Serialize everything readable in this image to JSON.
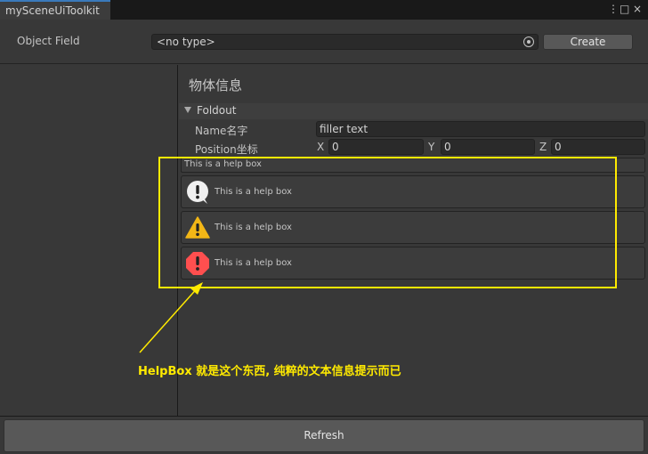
{
  "window": {
    "tab_title": "mySceneUiToolkit",
    "controls": [
      "⋮",
      "□",
      "×"
    ]
  },
  "toolbar": {
    "object_field_label": "Object Field",
    "object_field_value": "<no type>",
    "create_label": "Create"
  },
  "panel": {
    "title": "物体信息",
    "foldout_label": "Foldout",
    "name_label": "Name名字",
    "name_value": "filler text",
    "position_label": "Position坐标",
    "x_label": "X",
    "x_value": "0",
    "y_label": "Y",
    "y_value": "0",
    "z_label": "Z",
    "z_value": "0"
  },
  "helpboxes": [
    {
      "type": "none",
      "text": "This is a help box"
    },
    {
      "type": "info",
      "text": "This is a help box"
    },
    {
      "type": "warning",
      "text": "This is a help box"
    },
    {
      "type": "error",
      "text": "This is a help box"
    }
  ],
  "annotation": {
    "text": "HelpBox 就是这个东西, 纯粹的文本信息提示而已",
    "color": "#ffea00"
  },
  "footer": {
    "refresh_label": "Refresh"
  },
  "colors": {
    "background": "#383838",
    "field": "#2a2a2a",
    "button": "#585858",
    "warning": "#f2b616",
    "error": "#ff4f4f"
  }
}
